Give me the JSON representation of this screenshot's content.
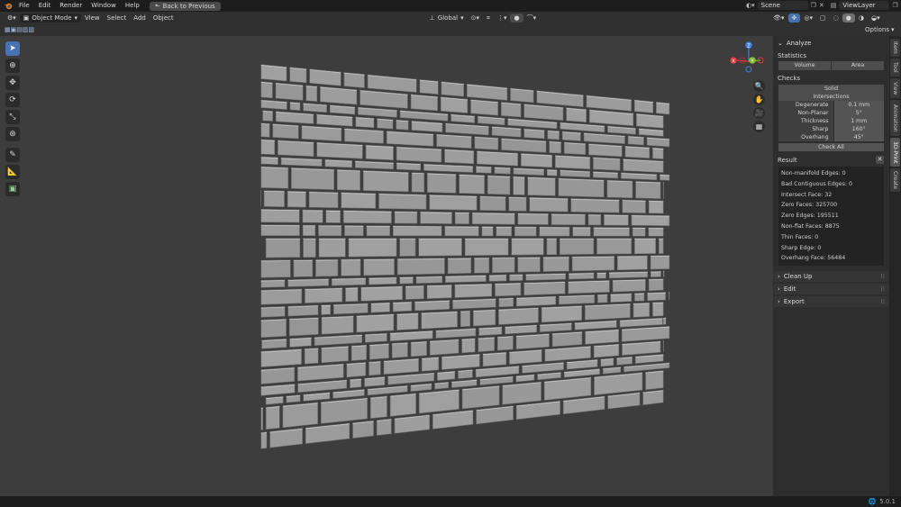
{
  "topbar": {
    "menus": [
      "File",
      "Edit",
      "Render",
      "Window",
      "Help"
    ],
    "back_label": "Back to Previous",
    "scene": "Scene",
    "view_layer": "ViewLayer"
  },
  "header": {
    "mode": "Object Mode",
    "menus": [
      "View",
      "Select",
      "Add",
      "Object"
    ],
    "transform": "Global",
    "options": "Options"
  },
  "npanel": {
    "analyze_title": "Analyze",
    "statistics_label": "Statistics",
    "stat_buttons": [
      "Volume",
      "Area"
    ],
    "checks_label": "Checks",
    "solid": "Solid",
    "intersections": "Intersections",
    "checks": [
      {
        "label": "Degenerate",
        "value": "0.1 mm"
      },
      {
        "label": "Non-Planar",
        "value": "5°"
      },
      {
        "label": "Thickness",
        "value": "1 mm"
      },
      {
        "label": "Sharp",
        "value": "160°"
      },
      {
        "label": "Overhang",
        "value": "45°"
      }
    ],
    "check_all": "Check All",
    "result_label": "Result",
    "results": [
      "Non-manifold Edges: 0",
      "Bad Contiguous Edges: 0",
      "Intersect Face: 32",
      "Zero Faces: 325700",
      "Zero Edges: 195511",
      "Non-flat Faces: 8875",
      "Thin Faces: 0",
      "Sharp Edge: 0",
      "Overhang Face: 56484"
    ],
    "sections": [
      "Clean Up",
      "Edit",
      "Export"
    ]
  },
  "tabs": [
    "Item",
    "Tool",
    "View",
    "Animation",
    "3D-Print",
    "Create"
  ],
  "gizmo": {
    "x": "X",
    "y": "Y",
    "z": "Z"
  },
  "status": {
    "version": "5.0.1"
  },
  "colors": {
    "accent": "#4772b3",
    "x_axis": "#e0393f",
    "y_axis": "#7fbf2a",
    "z_axis": "#3b82e0"
  }
}
